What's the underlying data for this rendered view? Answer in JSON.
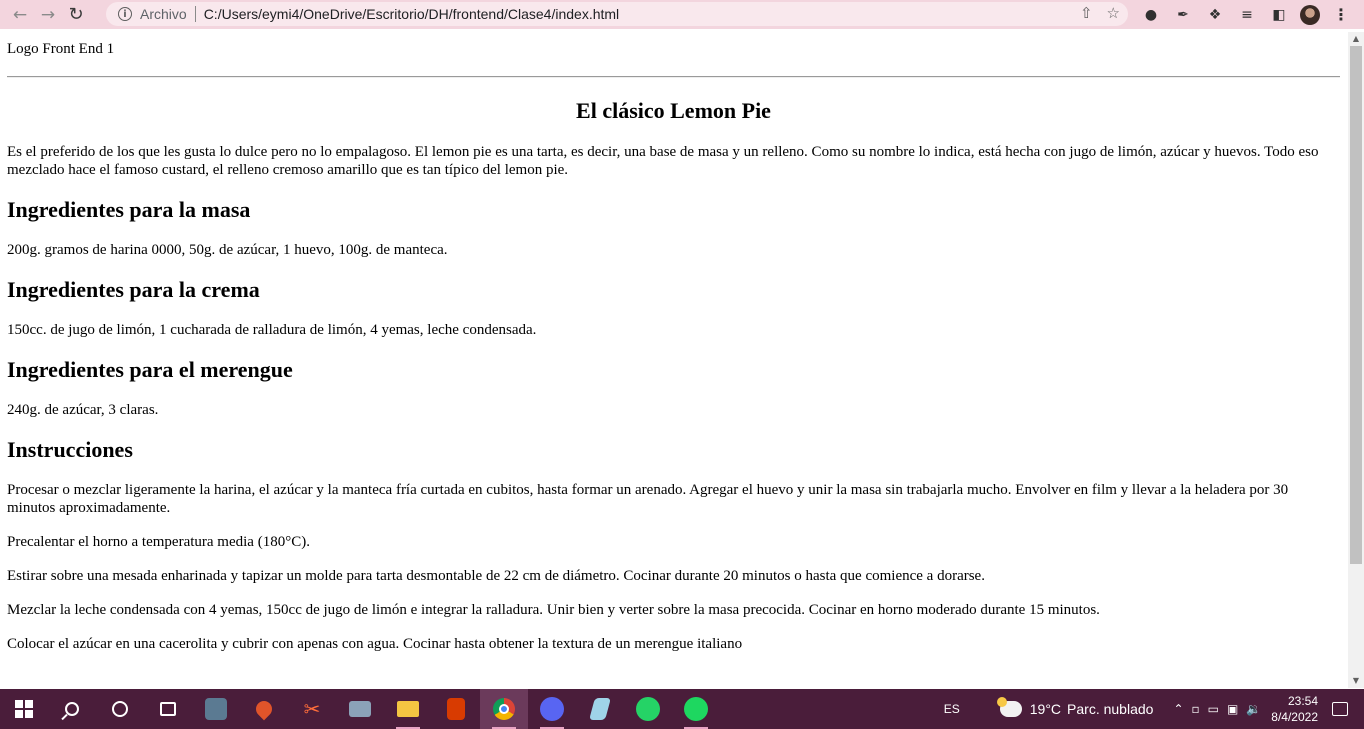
{
  "browser": {
    "origin_label": "Archivo",
    "url": "C:/Users/eymi4/OneDrive/Escritorio/DH/frontend/Clase4/index.html"
  },
  "page": {
    "logo": "Logo Front End 1",
    "title": "El clásico Lemon Pie",
    "intro": "Es el preferido de los que les gusta lo dulce pero no lo empalagoso. El lemon pie es una tarta, es decir, una base de masa y un relleno. Como su nombre lo indica, está hecha con jugo de limón, azúcar y huevos. Todo eso mezclado hace el famoso custard, el relleno cremoso amarillo que es tan típico del lemon pie.",
    "sections": [
      {
        "heading": "Ingredientes para la masa",
        "text": "200g. gramos de harina 0000, 50g. de azúcar, 1 huevo, 100g. de manteca."
      },
      {
        "heading": "Ingredientes para la crema",
        "text": "150cc. de jugo de limón, 1 cucharada de ralladura de limón, 4 yemas, leche condensada."
      },
      {
        "heading": "Ingredientes para el merengue",
        "text": "240g. de azúcar, 3 claras."
      }
    ],
    "instructions_heading": "Instrucciones",
    "instructions": [
      "Procesar o mezclar ligeramente la harina, el azúcar y la manteca fría curtada en cubitos, hasta formar un arenado. Agregar el huevo y unir la masa sin trabajarla mucho. Envolver en film y llevar a la heladera por 30 minutos aproximadamente.",
      "Precalentar el horno a temperatura media (180°C).",
      "Estirar sobre una mesada enharinada y tapizar un molde para tarta desmontable de 22 cm de diámetro. Cocinar durante 20 minutos o hasta que comience a dorarse.",
      "Mezclar la leche condensada con 4 yemas, 150cc de jugo de limón e integrar la ralladura. Unir bien y verter sobre la masa precocida. Cocinar en horno moderado durante 15 minutos.",
      "Colocar el azúcar en una cacerolita y cubrir con apenas con agua. Cocinar hasta obtener la textura de un merengue italiano"
    ]
  },
  "taskbar": {
    "language": "ES",
    "weather_temp": "19°C",
    "weather_desc": "Parc. nublado",
    "time": "23:54",
    "date": "8/4/2022"
  },
  "icons": {
    "back": "arrow-left-icon",
    "forward": "arrow-right-icon",
    "reload": "reload-icon",
    "site_info": "info-icon",
    "share": "share-icon",
    "bookmark": "star-icon"
  },
  "colors": {
    "toolbar_bg": "#f3d5de",
    "taskbar_bg": "#4a1d3a"
  }
}
